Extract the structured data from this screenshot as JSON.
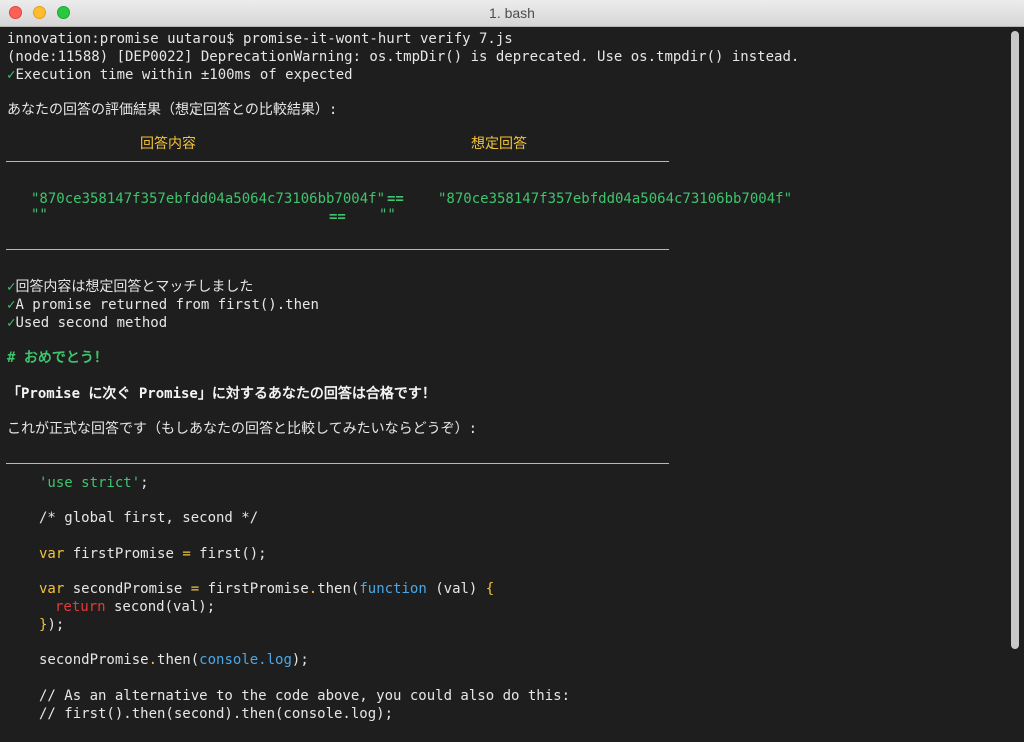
{
  "window": {
    "title": "1. bash"
  },
  "terminal": {
    "prompt_line": "innovation:promise uutarou$ promise-it-wont-hurt verify 7.js",
    "warning_line": "(node:11588) [DEP0022] DeprecationWarning: os.tmpDir() is deprecated. Use os.tmpdir() instead.",
    "check_mark": "✓",
    "exec_time": "Execution time within ±100ms of expected",
    "eval_heading": "あなたの回答の評価結果（想定回答との比較結果）:",
    "comparison": {
      "col_actual": "回答内容",
      "col_expected": "想定回答",
      "row1_actual": "\"870ce358147f357ebfdd04a5064c73106bb7004f\"",
      "row1_op": "==",
      "row1_expected": "\"870ce358147f357ebfdd04a5064c73106bb7004f\"",
      "row2_actual": "\"\"",
      "row2_op": "==",
      "row2_expected": "\"\""
    },
    "results": [
      "回答内容は想定回答とマッチしました",
      "A promise returned from first().then",
      "Used second method"
    ],
    "congrats": "# おめでとう！",
    "pass_message": "「Promise に次ぐ Promise」に対するあなたの回答は合格です！",
    "official_intro": "これが正式な回答です（もしあなたの回答と比較してみたいならどうぞ）:",
    "code": {
      "use_strict": "'use strict'",
      "semicolon": ";",
      "global_comment": "/* global first, second */",
      "kw_var": "var",
      "first_promise_name": " firstPromise ",
      "eq": "=",
      "first_call": " first();",
      "second_promise_name": " secondPromise ",
      "first_promise_ref": " firstPromise",
      "dot": ".",
      "then_open": "then(",
      "kw_function": "function",
      "params": " (val) ",
      "brace_open": "{",
      "kw_return": "return",
      "return_expr": " second(val);",
      "brace_close": "}",
      "close_paren": ");",
      "second_then_lhs": "secondPromise",
      "then_open2": "then(",
      "console_log": "console.log",
      "close_paren2": ");",
      "alt_comment": "// As an alternative to the code above, you could also do this:",
      "alt_code": "// first().then(second).then(console.log);"
    }
  },
  "colors": {
    "background": "#1e1e1e",
    "green": "#3ec46d",
    "yellow": "#f2c33a",
    "blue": "#4aa8e8",
    "red": "#e23b3b"
  }
}
